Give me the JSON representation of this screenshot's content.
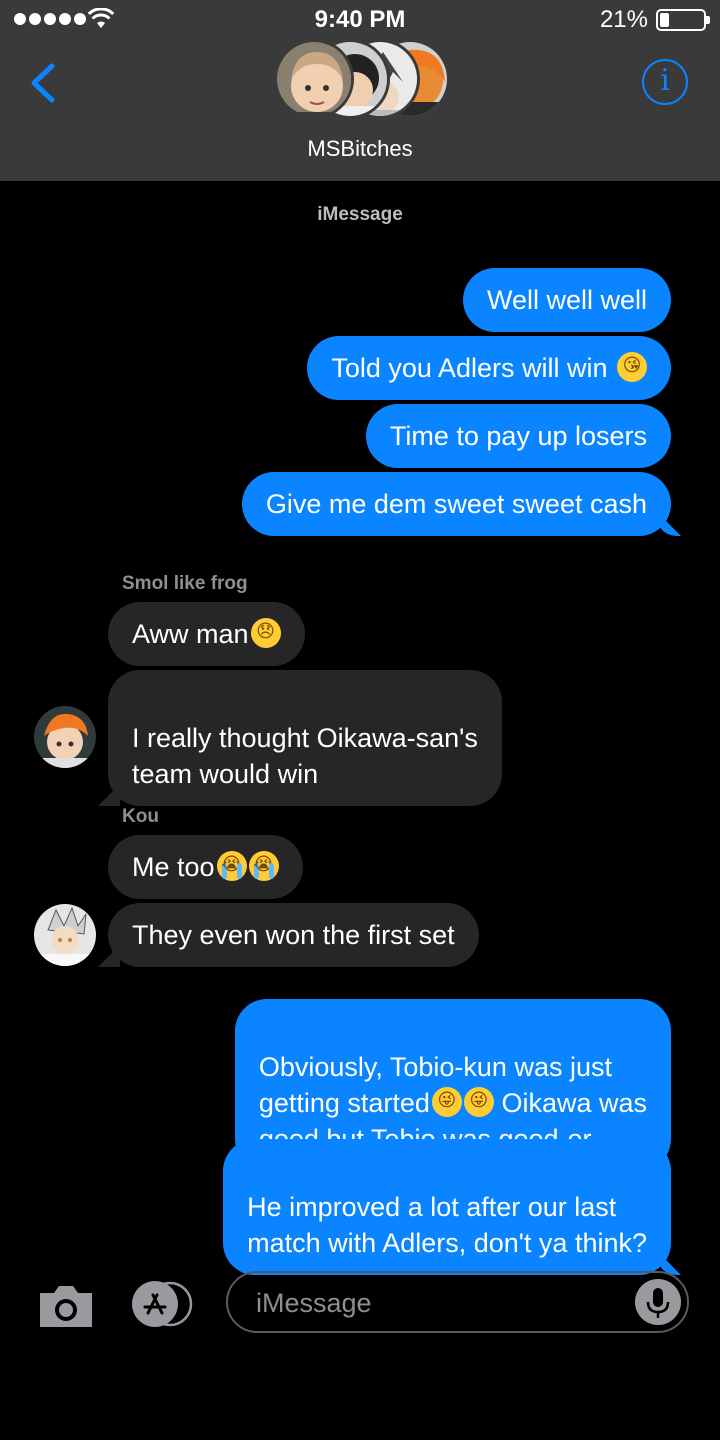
{
  "status_bar": {
    "time": "9:40 PM",
    "battery_percent": "21%",
    "battery_level": 0.21,
    "signal_bars": 5,
    "wifi_icon": "wifi-icon"
  },
  "header": {
    "group_name": "MSBitches",
    "back_icon": "chevron-left-icon",
    "info_icon": "info-icon",
    "info_glyph": "i",
    "accent_color": "#0a84ff"
  },
  "conversation": {
    "service_label": "iMessage",
    "outgoing_1": [
      "Well well well",
      "Told you Adlers will win",
      "Time to pay up losers",
      "Give me dem sweet sweet cash"
    ],
    "sender_1": {
      "name": "Smol like frog",
      "messages": [
        "Aww man",
        "I really thought Oikawa-san's\nteam would win"
      ]
    },
    "sender_2": {
      "name": "Kou",
      "messages": [
        "Me too",
        "They even won the first set"
      ]
    },
    "outgoing_2": [
      {
        "a": "Obviously, Tobio-kun was just\ngetting started",
        "b": " Oikawa was\ngood but Tobio was good-er"
      },
      "He improved a lot after our last\nmatch with Adlers, don't ya think?"
    ],
    "emoji": {
      "kiss": "kissing-face-emoji",
      "sad": "disappointed-face-emoji",
      "cry": "loudly-crying-face-emoji",
      "zany": "zany-face-emoji"
    }
  },
  "input_bar": {
    "placeholder": "iMessage",
    "camera_icon": "camera-icon",
    "apps_icon": "app-store-icon",
    "mic_icon": "microphone-icon"
  },
  "colors": {
    "outgoing_bubble": "#0a84ff",
    "incoming_bubble": "#262628",
    "header_bg": "#3a3a3a",
    "background": "#000000"
  }
}
